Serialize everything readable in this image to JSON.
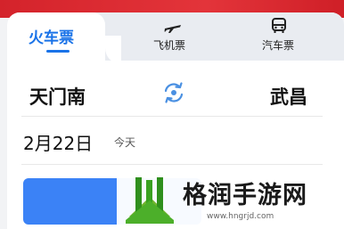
{
  "tabs": [
    {
      "label": "火车票",
      "icon": "train-icon",
      "active": true
    },
    {
      "label": "飞机票",
      "icon": "airplane-icon",
      "active": false
    },
    {
      "label": "汽车票",
      "icon": "bus-icon",
      "active": false
    }
  ],
  "route": {
    "from": "天门南",
    "to": "武昌",
    "swap_icon": "swap-icon"
  },
  "date": {
    "value": "2月22日",
    "label": "今天"
  },
  "search_button": {
    "label": ""
  },
  "watermark": {
    "title": "格润手游网",
    "url": "www.hngrjd.com"
  },
  "colors": {
    "accent": "#1a73e8",
    "button": "#3b82f6",
    "top_band": "#d4232b"
  }
}
